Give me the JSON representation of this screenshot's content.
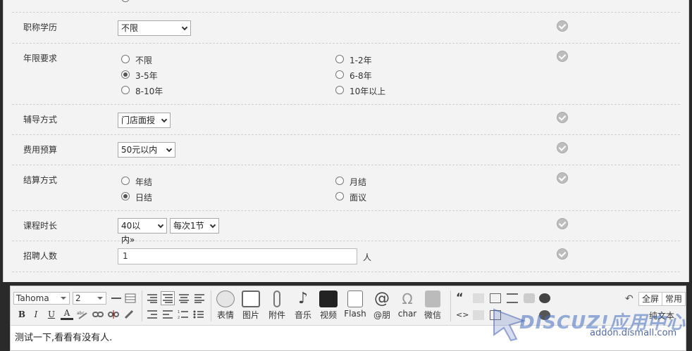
{
  "form": {
    "row_title": {
      "label": "职称学历",
      "select": "不限"
    },
    "row_years": {
      "label": "年限要求",
      "options": [
        "不限",
        "1-2年",
        "3-5年",
        "6-8年",
        "8-10年",
        "10年以上"
      ],
      "selected": "3-5年"
    },
    "row_mode": {
      "label": "辅导方式",
      "select": "门店面授"
    },
    "row_budget": {
      "label": "费用预算",
      "select": "50元以内"
    },
    "row_settle": {
      "label": "结算方式",
      "options": [
        "年结",
        "月结",
        "日结",
        "面议"
      ],
      "selected": "日结"
    },
    "row_duration": {
      "label": "课程时长",
      "select1": "40以内»",
      "select2": "每次1节"
    },
    "row_count": {
      "label": "招聘人数",
      "value": "1",
      "unit": "人"
    }
  },
  "editor": {
    "font": "Tahoma",
    "size": "2",
    "tools": [
      "表情",
      "图片",
      "附件",
      "音乐",
      "视频",
      "Flash",
      "@朋",
      "char",
      "微信"
    ],
    "fullscreen": "全屏",
    "common": "常用",
    "plaintext": "纯文本",
    "bold": "B",
    "italic": "I",
    "underline": "U",
    "fontcolor": "A",
    "content": "测试一下,看看有没有人."
  },
  "watermark": {
    "logo": "DISCUZ!应用中心",
    "url": "addon.dismall.com"
  }
}
